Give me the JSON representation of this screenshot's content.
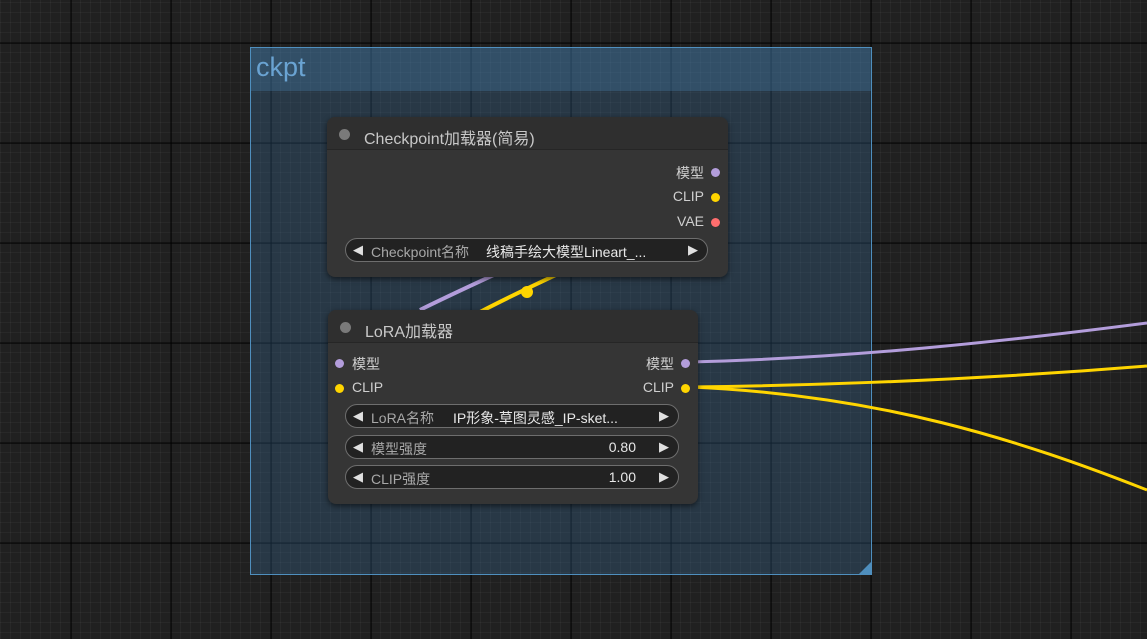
{
  "group": {
    "title": "ckpt"
  },
  "checkpoint_node": {
    "title": "Checkpoint加载器(简易)",
    "outputs": [
      {
        "label": "模型",
        "color": "#b39ddb"
      },
      {
        "label": "CLIP",
        "color": "#ffd500"
      },
      {
        "label": "VAE",
        "color": "#ff6e6e"
      }
    ],
    "widgets": [
      {
        "label": "Checkpoint名称",
        "value": "线稿手绘大模型Lineart_..."
      }
    ]
  },
  "lora_node": {
    "title": "LoRA加载器",
    "inputs": [
      {
        "label": "模型",
        "color": "#b39ddb"
      },
      {
        "label": "CLIP",
        "color": "#ffd500"
      }
    ],
    "outputs": [
      {
        "label": "模型",
        "color": "#b39ddb"
      },
      {
        "label": "CLIP",
        "color": "#ffd500"
      }
    ],
    "widgets": [
      {
        "label": "LoRA名称",
        "value": "IP形象-草图灵感_IP-sket..."
      },
      {
        "label": "模型强度",
        "value": "0.80"
      },
      {
        "label": "CLIP强度",
        "value": "1.00"
      }
    ]
  },
  "colors": {
    "model_wire": "#b39ddb",
    "clip_wire": "#ffd500",
    "vae": "#ff6e6e",
    "group_border": "#4f8fbe"
  },
  "icons": {
    "arrow_left": "◀",
    "arrow_right": "▶"
  }
}
